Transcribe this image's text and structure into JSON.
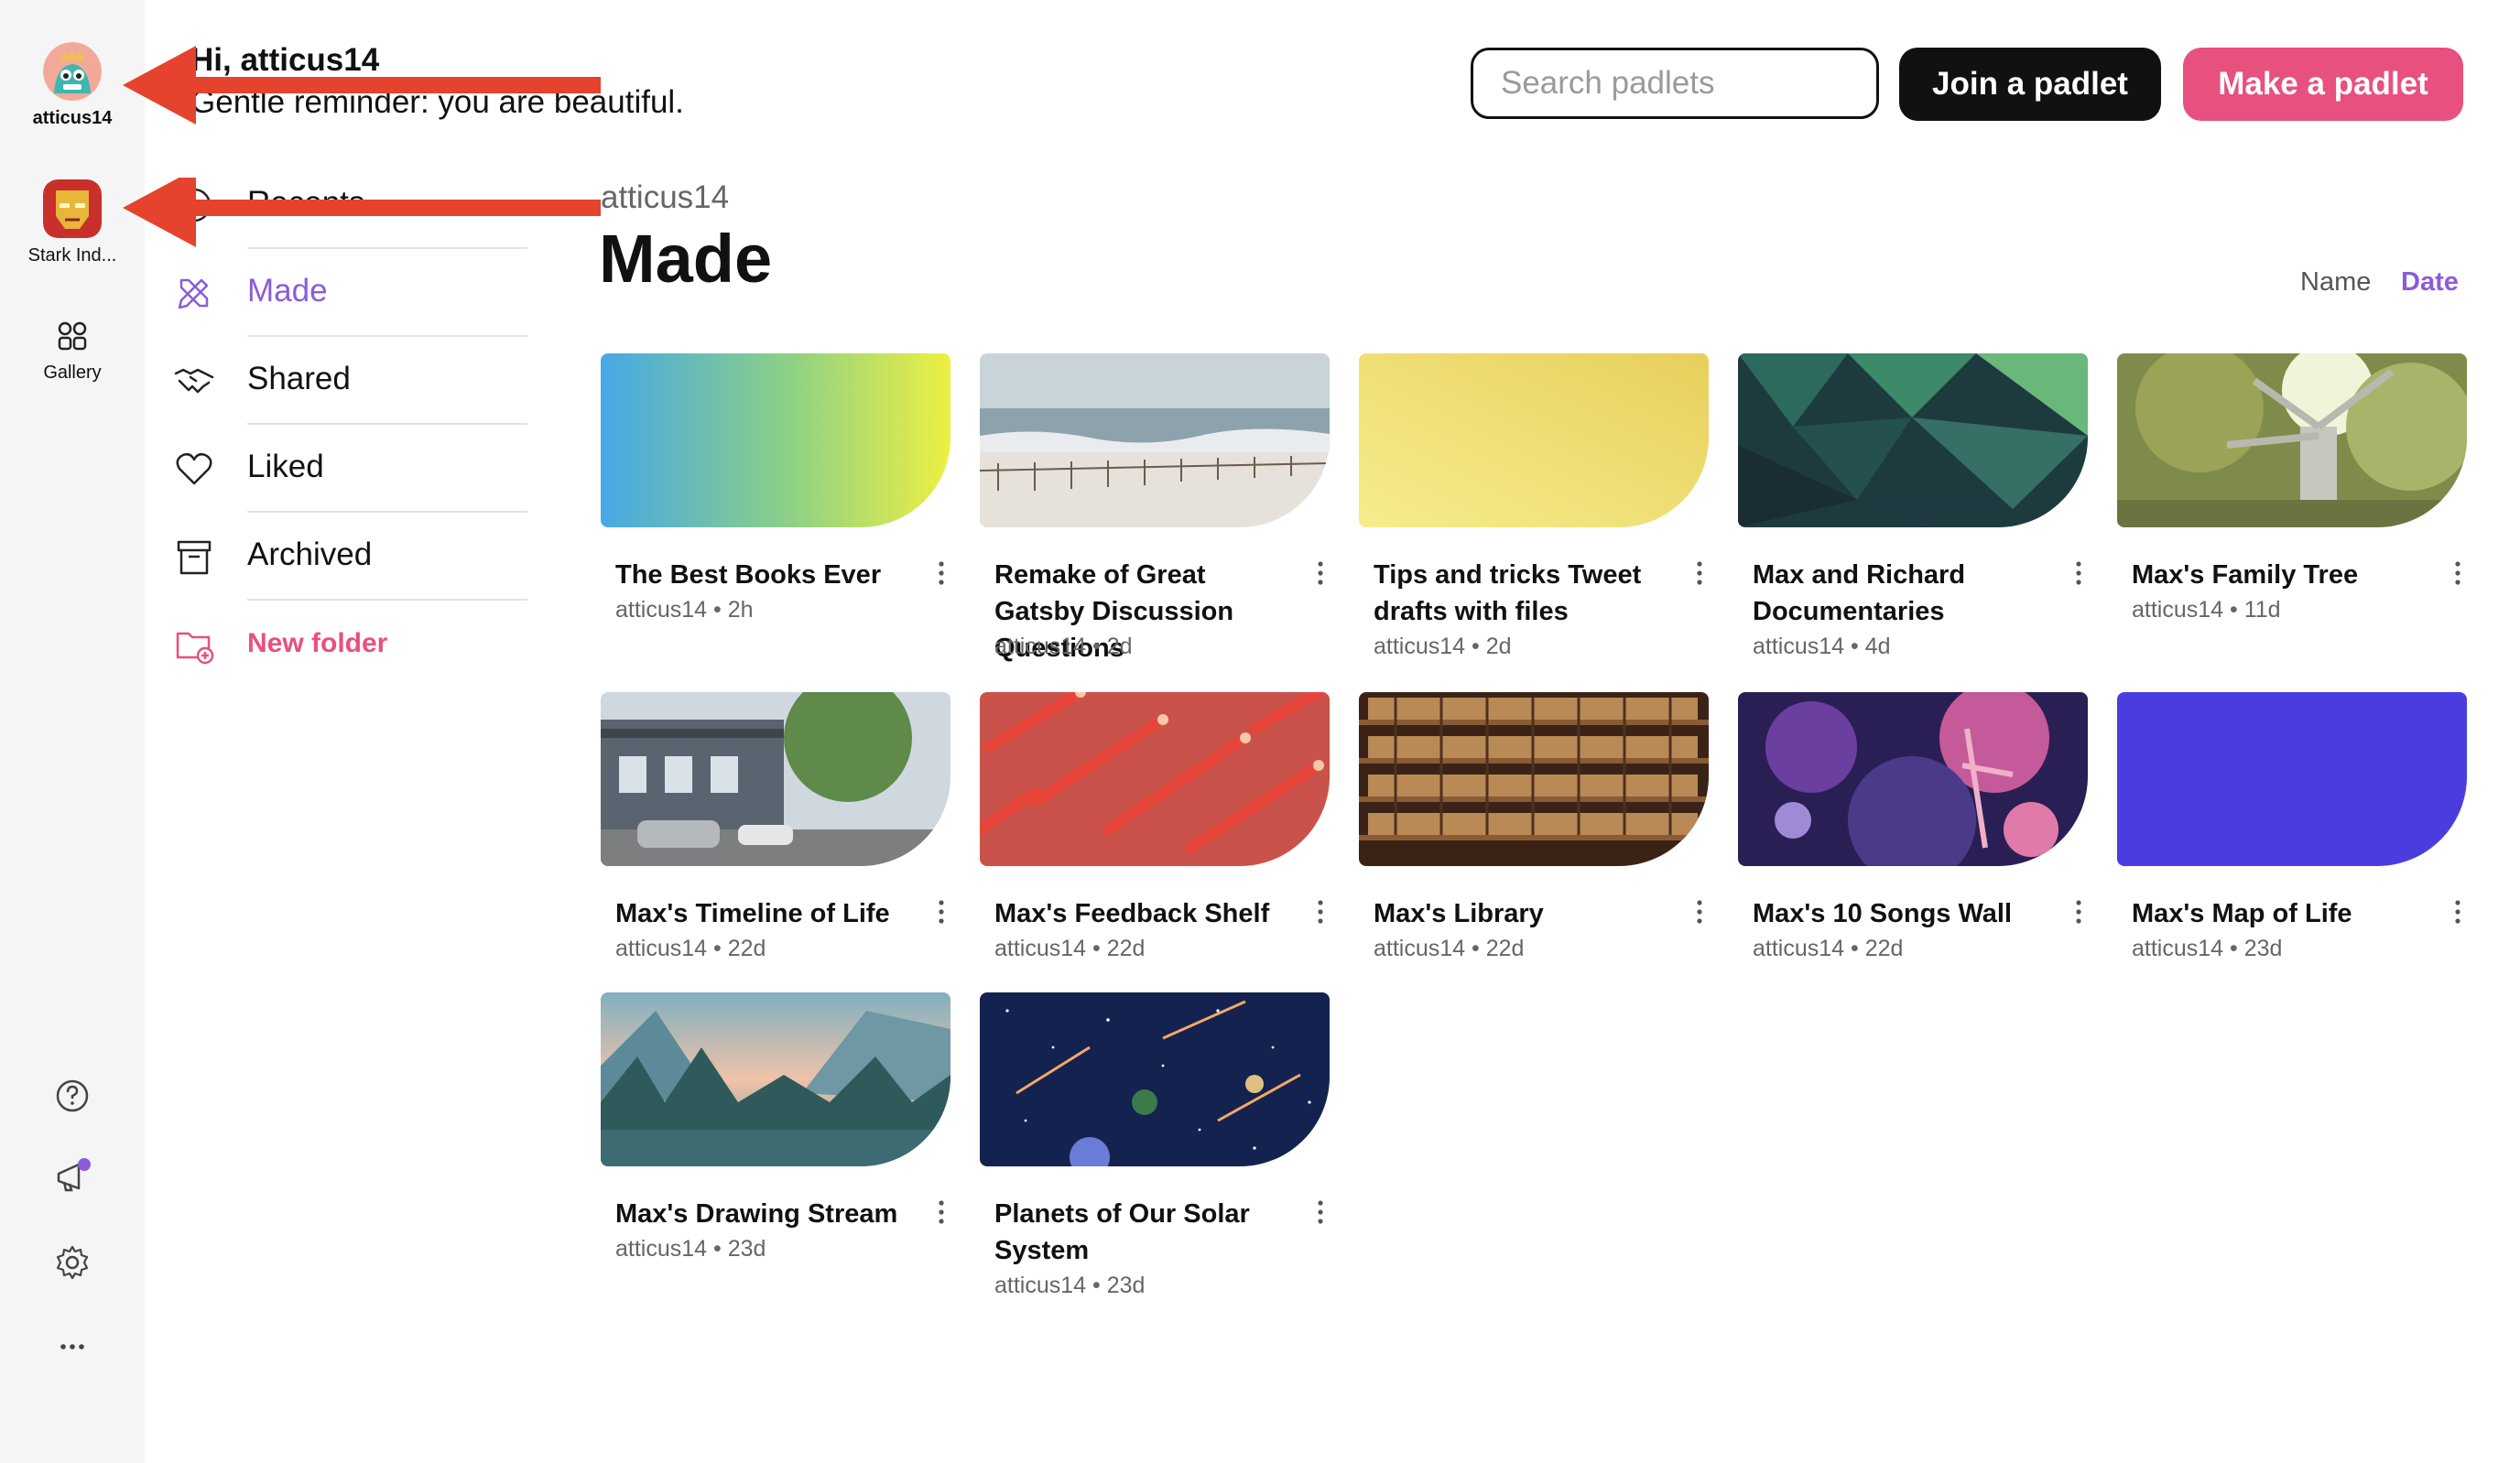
{
  "rail": {
    "user": {
      "label": "atticus14"
    },
    "org": {
      "label": "Stark Ind..."
    },
    "gallery": {
      "label": "Gallery"
    },
    "icons": [
      "help-icon",
      "announcement-icon",
      "settings-icon",
      "more-icon"
    ]
  },
  "header": {
    "greeting": "Hi, atticus14",
    "reminder": "Gentle reminder: you are beautiful.",
    "search_placeholder": "Search padlets",
    "join_label": "Join a padlet",
    "make_label": "Make a padlet"
  },
  "nav": {
    "items": [
      {
        "label": "Recents",
        "icon": "clock-icon"
      },
      {
        "label": "Made",
        "icon": "pencil-ruler-icon",
        "active": true
      },
      {
        "label": "Shared",
        "icon": "handshake-icon"
      },
      {
        "label": "Liked",
        "icon": "heart-icon"
      },
      {
        "label": "Archived",
        "icon": "archive-box-icon"
      }
    ],
    "new_folder": "New folder"
  },
  "main": {
    "breadcrumb": "atticus14",
    "title": "Made",
    "sort_name": "Name",
    "sort_date": "Date",
    "cards": [
      {
        "title": "The Best Books Ever",
        "meta": "atticus14 • 2h",
        "thumb": "gradient-blue-yellow"
      },
      {
        "title": "Remake of Great Gatsby Discussion Questions",
        "meta": "atticus14 • 2d",
        "thumb": "beach"
      },
      {
        "title": "Tips and tricks Tweet drafts with files",
        "meta": "atticus14 • 2d",
        "thumb": "yellow"
      },
      {
        "title": "Max and Richard Documentaries",
        "meta": "atticus14 • 4d",
        "thumb": "green-polygons"
      },
      {
        "title": "Max's Family Tree",
        "meta": "atticus14 • 11d",
        "thumb": "tree"
      },
      {
        "title": "Max's Timeline of Life",
        "meta": "atticus14 • 22d",
        "thumb": "street"
      },
      {
        "title": "Max's Feedback Shelf",
        "meta": "atticus14 • 22d",
        "thumb": "pencils"
      },
      {
        "title": "Max's Library",
        "meta": "atticus14 • 22d",
        "thumb": "bookshelf"
      },
      {
        "title": "Max's 10 Songs Wall",
        "meta": "atticus14 • 22d",
        "thumb": "orchestra"
      },
      {
        "title": "Max's Map of Life",
        "meta": "atticus14 • 23d",
        "thumb": "blue"
      },
      {
        "title": "Max's Drawing Stream",
        "meta": "atticus14 • 23d",
        "thumb": "mountain-lake"
      },
      {
        "title": "Planets of Our Solar System",
        "meta": "atticus14 • 23d",
        "thumb": "space"
      }
    ]
  },
  "colors": {
    "accent_purple": "#8a5cd8",
    "brand_pink": "#e8507f",
    "annotation_red": "#e5432d"
  }
}
